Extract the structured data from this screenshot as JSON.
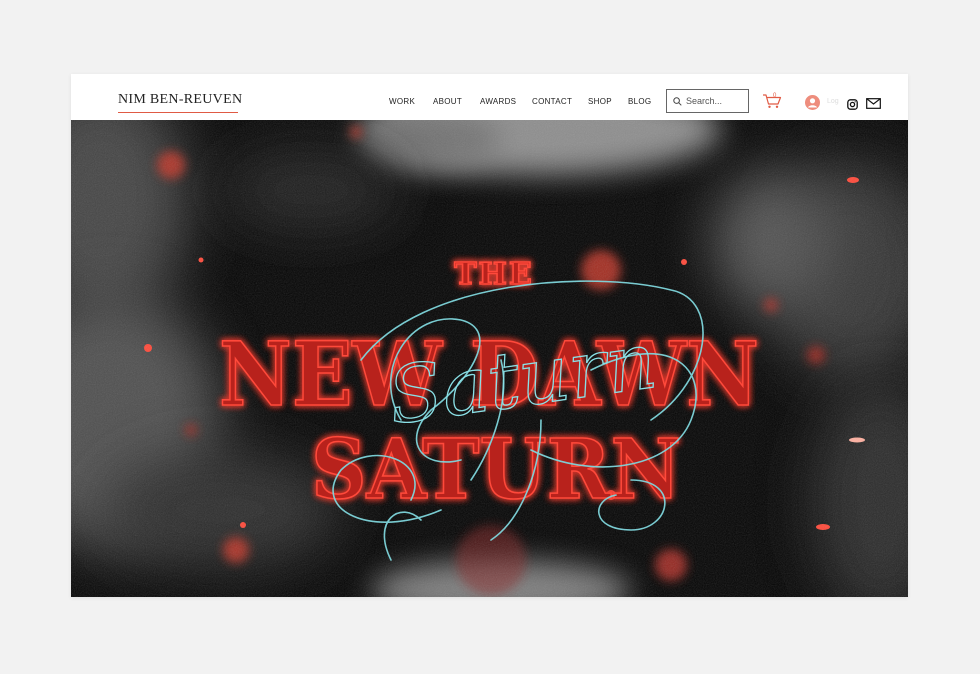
{
  "site": {
    "logo": "NIM BEN-REUVEN"
  },
  "nav": {
    "items": [
      "WORK",
      "ABOUT",
      "AWARDS",
      "CONTACT",
      "SHOP",
      "BLOG"
    ]
  },
  "search": {
    "placeholder": "Search..."
  },
  "cart": {
    "count": "0"
  },
  "account": {
    "label": "Log"
  },
  "hero": {
    "line1": "THE",
    "line2": "NEW DAWN",
    "line3": "SATURN",
    "script": "Saturn"
  },
  "colors": {
    "accent": "#e05a44",
    "neon_red": "#ff3a2e",
    "neon_cyan": "#7fd6dc",
    "background": "#060606"
  },
  "icons": [
    "search-icon",
    "cart-icon",
    "avatar-icon",
    "instagram-icon",
    "mail-icon"
  ]
}
